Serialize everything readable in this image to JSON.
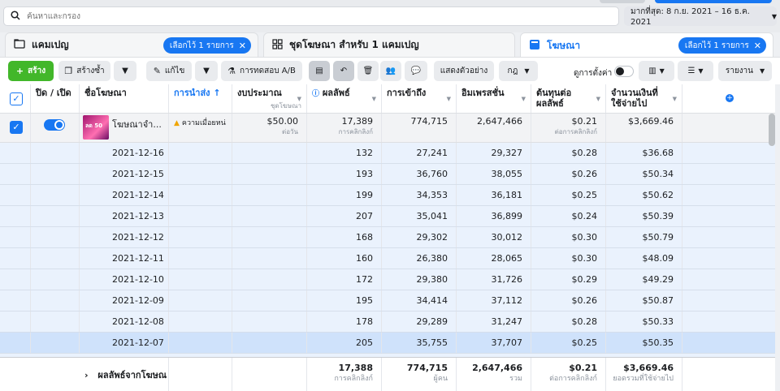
{
  "search": {
    "placeholder": "ค้นหาและกรอง"
  },
  "date_range": "มากที่สุด: 8 ก.ย. 2021 – 16 ธ.ค. 2021",
  "tabs": [
    {
      "label": "แคมเปญ",
      "chip": "เลือกไว้ 1 รายการ"
    },
    {
      "label": "ชุดโฆษณา สำหรับ 1 แคมเปญ",
      "chip": ""
    },
    {
      "label": "โฆษณา",
      "chip": "เลือกไว้ 1 รายการ"
    }
  ],
  "toolbar": {
    "create": "สร้าง",
    "duplicate": "สร้างซ้ำ",
    "edit": "แก้ไข",
    "ab_test": "การทดสอบ A/B",
    "preview": "แสดงตัวอย่าง",
    "rules": "กฎ",
    "view_settings": "ดูการตั้งค่า",
    "reports": "รายงาน"
  },
  "columns": {
    "on_off": "ปิด / เปิด",
    "ad_name": "ชื่อโฆษณา",
    "delivery": "การนำส่ง ↑",
    "budget": "งบประมาณ",
    "budget_sub": "ชุดโฆษณา",
    "results": "ผลลัพธ์",
    "reach": "การเข้าถึง",
    "impressions": "อิมเพรสชั่น",
    "cost_per_result": "ต้นทุนต่อผลลัพธ์",
    "amount_spent": "จำนวนเงินที่ใช้จ่ายไป"
  },
  "ad_row": {
    "name": "โฆษณาจำ...",
    "thumb_text": "ลด 50",
    "delivery": "ความเมื่อยหน่",
    "budget": "$50.00",
    "budget_sub": "ต่อวัน",
    "results": "17,389",
    "results_sub": "การคลิกลิงก์",
    "reach": "774,715",
    "impressions": "2,647,466",
    "cpr": "$0.21",
    "cpr_sub": "ต่อการคลิกลิงก์",
    "spent": "$3,669.46"
  },
  "daily_rows": [
    {
      "date": "2021-12-16",
      "results": "132",
      "reach": "27,241",
      "impressions": "29,327",
      "cpr": "$0.28",
      "spent": "$36.68"
    },
    {
      "date": "2021-12-15",
      "results": "193",
      "reach": "36,760",
      "impressions": "38,055",
      "cpr": "$0.26",
      "spent": "$50.34"
    },
    {
      "date": "2021-12-14",
      "results": "199",
      "reach": "34,353",
      "impressions": "36,181",
      "cpr": "$0.25",
      "spent": "$50.62"
    },
    {
      "date": "2021-12-13",
      "results": "207",
      "reach": "35,041",
      "impressions": "36,899",
      "cpr": "$0.24",
      "spent": "$50.39"
    },
    {
      "date": "2021-12-12",
      "results": "168",
      "reach": "29,302",
      "impressions": "30,012",
      "cpr": "$0.30",
      "spent": "$50.79"
    },
    {
      "date": "2021-12-11",
      "results": "160",
      "reach": "26,380",
      "impressions": "28,065",
      "cpr": "$0.30",
      "spent": "$48.09"
    },
    {
      "date": "2021-12-10",
      "results": "172",
      "reach": "29,380",
      "impressions": "31,726",
      "cpr": "$0.29",
      "spent": "$49.29"
    },
    {
      "date": "2021-12-09",
      "results": "195",
      "reach": "34,414",
      "impressions": "37,112",
      "cpr": "$0.26",
      "spent": "$50.87"
    },
    {
      "date": "2021-12-08",
      "results": "178",
      "reach": "29,289",
      "impressions": "31,247",
      "cpr": "$0.28",
      "spent": "$50.33"
    },
    {
      "date": "2021-12-07",
      "results": "205",
      "reach": "35,755",
      "impressions": "37,707",
      "cpr": "$0.25",
      "spent": "$50.35"
    }
  ],
  "footer": {
    "label": "ผลลัพธ์จากโฆษณ",
    "results": "17,388",
    "results_sub": "การคลิกลิงก์",
    "reach": "774,715",
    "reach_sub": "ผู้คน",
    "impressions": "2,647,466",
    "impressions_sub": "รวม",
    "cpr": "$0.21",
    "cpr_sub": "ต่อการคลิกลิงก์",
    "spent": "$3,669.46",
    "spent_sub": "ยอดรวมที่ใช้จ่ายไป"
  },
  "colors": {
    "accent": "#1877f2",
    "create": "#42b72a",
    "row_bg": "#eaf2fd",
    "row_selected": "#cfe2fb"
  }
}
